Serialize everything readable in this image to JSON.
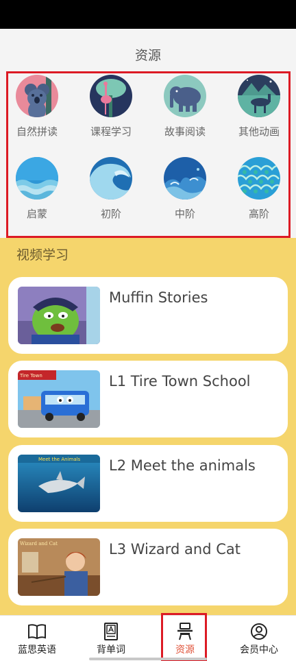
{
  "header": {
    "title": "资源"
  },
  "categories": [
    {
      "label": "自然拼读",
      "icon": "koala-icon"
    },
    {
      "label": "课程学习",
      "icon": "flamingo-icon"
    },
    {
      "label": "故事阅读",
      "icon": "elephant-icon"
    },
    {
      "label": "其他动画",
      "icon": "camel-icon"
    },
    {
      "label": "启蒙",
      "icon": "calm-wave-icon"
    },
    {
      "label": "初阶",
      "icon": "curl-wave-icon"
    },
    {
      "label": "中阶",
      "icon": "splash-wave-icon"
    },
    {
      "label": "高阶",
      "icon": "pattern-wave-icon"
    }
  ],
  "section": {
    "title": "视频学习"
  },
  "videos": [
    {
      "title": "Muffin Stories"
    },
    {
      "title": "L1 Tire Town School",
      "thumb_text": "Tire Town"
    },
    {
      "title": "L2 Meet the animals",
      "thumb_text": "Meet the Animals"
    },
    {
      "title": "L3 Wizard and Cat",
      "thumb_text": "Wizard and Cat"
    }
  ],
  "nav": [
    {
      "label": "蓝思英语",
      "icon": "book-open-icon"
    },
    {
      "label": "背单词",
      "icon": "word-book-icon"
    },
    {
      "label": "资源",
      "icon": "desk-icon",
      "active": true
    },
    {
      "label": "会员中心",
      "icon": "user-circle-icon"
    }
  ],
  "colors": {
    "highlight": "#dc1a24",
    "accent": "#e0533a",
    "panel": "#f5d56c"
  }
}
